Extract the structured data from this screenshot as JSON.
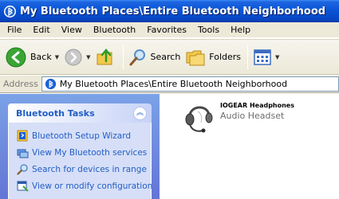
{
  "window": {
    "title": "My Bluetooth Places\\Entire Bluetooth Neighborhood"
  },
  "menu": {
    "items": [
      {
        "label": "File"
      },
      {
        "label": "Edit"
      },
      {
        "label": "View"
      },
      {
        "label": "Bluetooth"
      },
      {
        "label": "Favorites"
      },
      {
        "label": "Tools"
      },
      {
        "label": "Help"
      }
    ]
  },
  "toolbar": {
    "back_label": "Back",
    "search_label": "Search",
    "folders_label": "Folders"
  },
  "address": {
    "label": "Address",
    "value": "My Bluetooth Places\\Entire Bluetooth Neighborhood"
  },
  "taskpane": {
    "title": "Bluetooth Tasks",
    "tasks": [
      {
        "label": "Bluetooth Setup Wizard",
        "icon": "wizard-icon"
      },
      {
        "label": "View My Bluetooth services",
        "icon": "services-icon"
      },
      {
        "label": "Search for devices in range",
        "icon": "search-icon"
      },
      {
        "label": "View or modify configuration",
        "icon": "config-icon"
      }
    ]
  },
  "content": {
    "devices": [
      {
        "name": "IOGEAR Headphones",
        "type": "Audio Headset",
        "icon": "headset-icon"
      }
    ]
  },
  "colors": {
    "titlebar": "#0a57d8",
    "task_link": "#215dc6",
    "taskpane_bg": "#6375d6"
  }
}
